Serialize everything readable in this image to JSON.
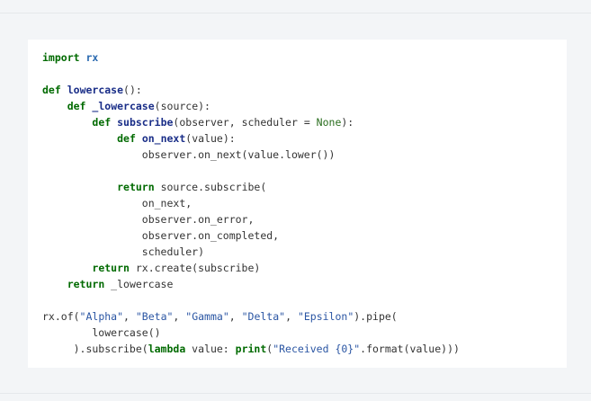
{
  "colors": {
    "page_background": "#f3f5f7",
    "code_background": "#ffffff",
    "keyword": "#006a00",
    "function_name": "#1a2e88",
    "module_name": "#2a6ab0",
    "string": "#2a55a3",
    "constant": "#2a6e1e",
    "text": "#333333"
  },
  "code": {
    "language": "python",
    "lines": [
      [
        {
          "t": "kw",
          "v": "import"
        },
        {
          "t": "txt",
          "v": " "
        },
        {
          "t": "mod",
          "v": "rx"
        }
      ],
      [],
      [
        {
          "t": "kw",
          "v": "def"
        },
        {
          "t": "txt",
          "v": " "
        },
        {
          "t": "fn",
          "v": "lowercase"
        },
        {
          "t": "txt",
          "v": "():"
        }
      ],
      [
        {
          "t": "txt",
          "v": "    "
        },
        {
          "t": "kw",
          "v": "def"
        },
        {
          "t": "txt",
          "v": " "
        },
        {
          "t": "fn",
          "v": "_lowercase"
        },
        {
          "t": "txt",
          "v": "(source):"
        }
      ],
      [
        {
          "t": "txt",
          "v": "        "
        },
        {
          "t": "kw",
          "v": "def"
        },
        {
          "t": "txt",
          "v": " "
        },
        {
          "t": "fn",
          "v": "subscribe"
        },
        {
          "t": "txt",
          "v": "(observer, scheduler = "
        },
        {
          "t": "const",
          "v": "None"
        },
        {
          "t": "txt",
          "v": "):"
        }
      ],
      [
        {
          "t": "txt",
          "v": "            "
        },
        {
          "t": "kw",
          "v": "def"
        },
        {
          "t": "txt",
          "v": " "
        },
        {
          "t": "fn",
          "v": "on_next"
        },
        {
          "t": "txt",
          "v": "(value):"
        }
      ],
      [
        {
          "t": "txt",
          "v": "                observer.on_next(value.lower())"
        }
      ],
      [],
      [
        {
          "t": "txt",
          "v": "            "
        },
        {
          "t": "kw",
          "v": "return"
        },
        {
          "t": "txt",
          "v": " source.subscribe("
        }
      ],
      [
        {
          "t": "txt",
          "v": "                on_next,"
        }
      ],
      [
        {
          "t": "txt",
          "v": "                observer.on_error,"
        }
      ],
      [
        {
          "t": "txt",
          "v": "                observer.on_completed,"
        }
      ],
      [
        {
          "t": "txt",
          "v": "                scheduler)"
        }
      ],
      [
        {
          "t": "txt",
          "v": "        "
        },
        {
          "t": "kw",
          "v": "return"
        },
        {
          "t": "txt",
          "v": " rx.create(subscribe)"
        }
      ],
      [
        {
          "t": "txt",
          "v": "    "
        },
        {
          "t": "kw",
          "v": "return"
        },
        {
          "t": "txt",
          "v": " _lowercase"
        }
      ],
      [],
      [
        {
          "t": "txt",
          "v": "rx.of("
        },
        {
          "t": "str",
          "v": "\"Alpha\""
        },
        {
          "t": "txt",
          "v": ", "
        },
        {
          "t": "str",
          "v": "\"Beta\""
        },
        {
          "t": "txt",
          "v": ", "
        },
        {
          "t": "str",
          "v": "\"Gamma\""
        },
        {
          "t": "txt",
          "v": ", "
        },
        {
          "t": "str",
          "v": "\"Delta\""
        },
        {
          "t": "txt",
          "v": ", "
        },
        {
          "t": "str",
          "v": "\"Epsilon\""
        },
        {
          "t": "txt",
          "v": ").pipe("
        }
      ],
      [
        {
          "t": "txt",
          "v": "        lowercase()"
        }
      ],
      [
        {
          "t": "txt",
          "v": "     ).subscribe("
        },
        {
          "t": "kw",
          "v": "lambda"
        },
        {
          "t": "txt",
          "v": " value: "
        },
        {
          "t": "kw",
          "v": "print"
        },
        {
          "t": "txt",
          "v": "("
        },
        {
          "t": "str",
          "v": "\"Received {0}\""
        },
        {
          "t": "txt",
          "v": ".format(value)))"
        }
      ]
    ]
  }
}
